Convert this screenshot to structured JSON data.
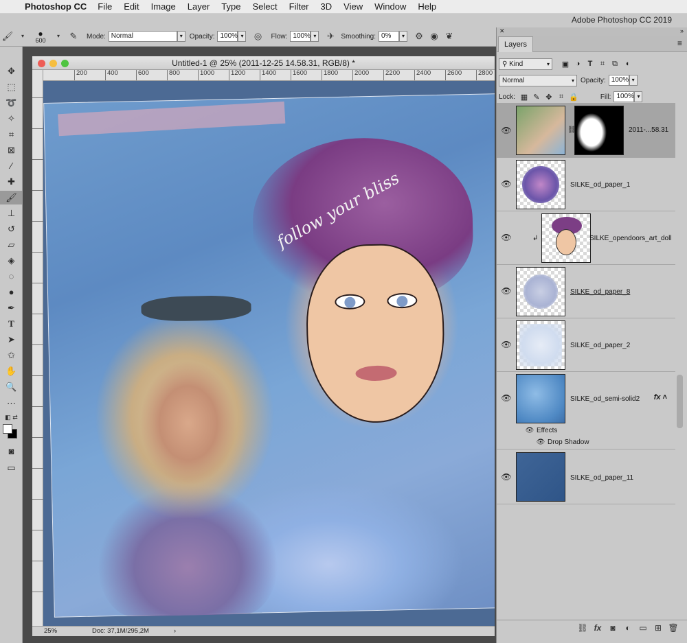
{
  "menubar": {
    "apple": "",
    "app": "Photoshop CC",
    "items": [
      "File",
      "Edit",
      "Image",
      "Layer",
      "Type",
      "Select",
      "Filter",
      "3D",
      "View",
      "Window",
      "Help"
    ]
  },
  "window_title": "Adobe Photoshop CC 2019",
  "options": {
    "brush_size": "600",
    "mode_label": "Mode:",
    "mode_value": "Normal",
    "opacity_label": "Opacity:",
    "opacity_value": "100%",
    "flow_label": "Flow:",
    "flow_value": "100%",
    "smoothing_label": "Smoothing:",
    "smoothing_value": "0%"
  },
  "document": {
    "title": "Untitled-1 @ 25% (2011-12-25 14.58.31, RGB/8) *",
    "ruler_h": [
      "200",
      "400",
      "600",
      "800",
      "1000",
      "1200",
      "1400",
      "1600",
      "1800",
      "2000",
      "2200",
      "2400",
      "2600",
      "2800"
    ],
    "canvas_text": "follow your bliss",
    "zoom": "25%",
    "doc_size": "Doc: 37,1M/295,2M"
  },
  "layers_panel": {
    "tab": "Layers",
    "filter_value": "Kind",
    "blend_mode": "Normal",
    "opacity_label": "Opacity:",
    "opacity_value": "100%",
    "lock_label": "Lock:",
    "fill_label": "Fill:",
    "fill_value": "100%",
    "layers": [
      {
        "name": "2011-...58.31"
      },
      {
        "name": "SILKE_od_paper_1"
      },
      {
        "name": "SILKE_opendoors_art_doll"
      },
      {
        "name": "SILKE_od_paper_8"
      },
      {
        "name": "SILKE_od_paper_2"
      },
      {
        "name": "SILKE_od_semi-solid2"
      },
      {
        "name": "SILKE_od_paper_11"
      }
    ],
    "effects_label": "Effects",
    "drop_shadow_label": "Drop Shadow",
    "fx_label": "fx"
  }
}
